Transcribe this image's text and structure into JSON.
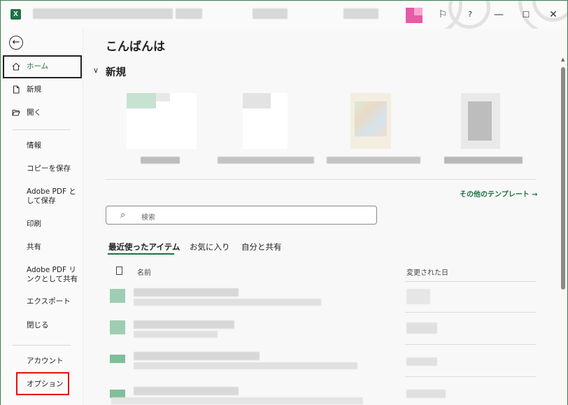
{
  "titlebar": {
    "app_icon": "excel-icon",
    "help": "?",
    "minimize": "—",
    "maximize": "☐",
    "close": "✕"
  },
  "sidebar": {
    "back_icon": "back-arrow-icon",
    "items": [
      {
        "id": "home",
        "label": "ホーム",
        "icon": "home-icon"
      },
      {
        "id": "new",
        "label": "新規",
        "icon": "new-file-icon"
      },
      {
        "id": "open",
        "label": "開く",
        "icon": "folder-open-icon"
      },
      {
        "id": "info",
        "label": "情報"
      },
      {
        "id": "save-copy",
        "label": "コピーを保存"
      },
      {
        "id": "save-pdf",
        "label": "Adobe PDF と\nして保存"
      },
      {
        "id": "print",
        "label": "印刷"
      },
      {
        "id": "share",
        "label": "共有"
      },
      {
        "id": "share-pdf-link",
        "label": "Adobe PDF リ\nンクとして共有"
      },
      {
        "id": "export",
        "label": "エクスポート"
      },
      {
        "id": "close",
        "label": "閉じる"
      },
      {
        "id": "account",
        "label": "アカウント"
      },
      {
        "id": "options",
        "label": "オプション"
      }
    ]
  },
  "main": {
    "greeting": "こんばんは",
    "new_section": "新規",
    "more_templates": "その他のテンプレート →",
    "search": {
      "placeholder": "検索"
    },
    "tabs": [
      {
        "label": "最近使ったアイテム"
      },
      {
        "label": "お気に入り"
      },
      {
        "label": "自分と共有"
      }
    ],
    "columns": {
      "name": "名前",
      "modified": "変更された日"
    }
  },
  "colors": {
    "accent": "#1e7145",
    "highlight": "#e01010"
  }
}
